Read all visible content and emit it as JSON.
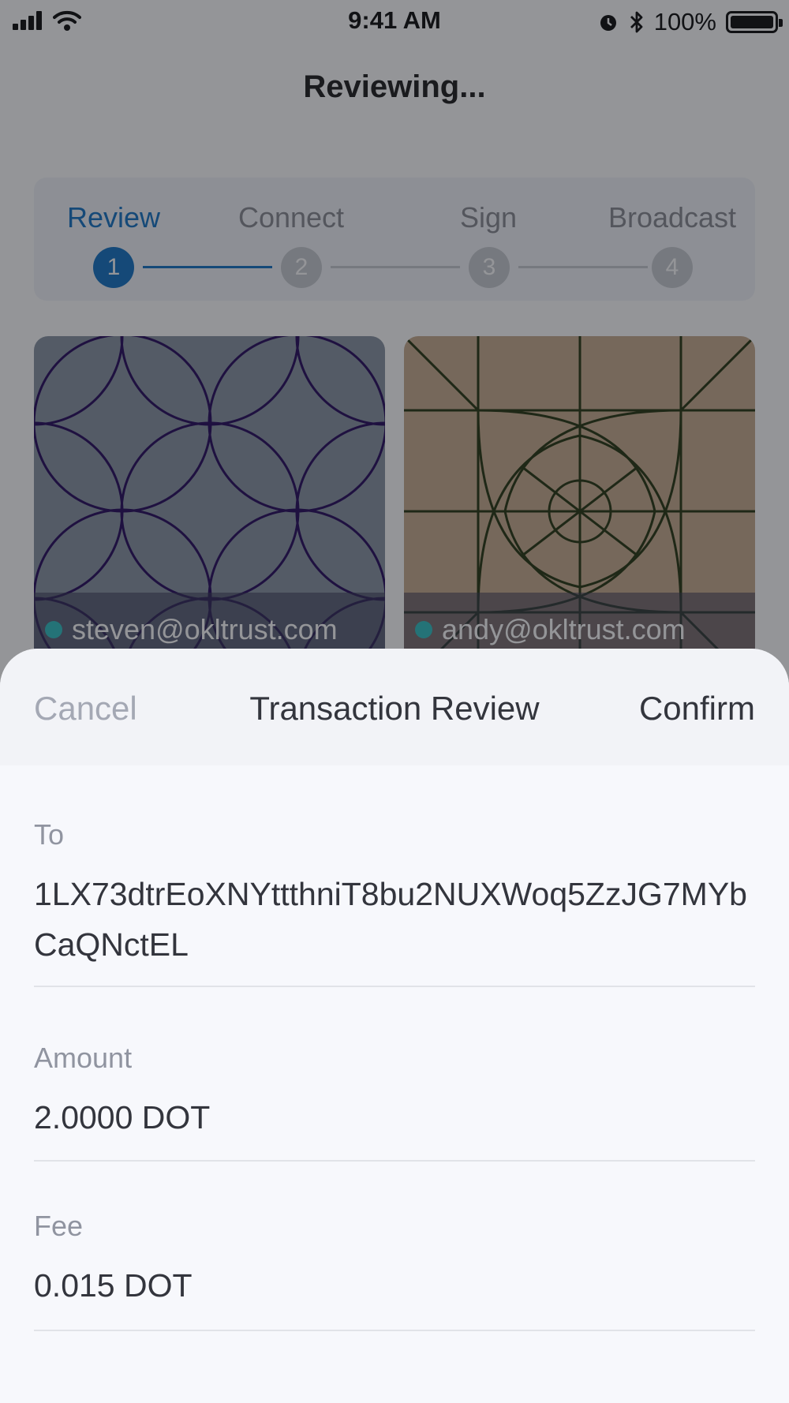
{
  "status_bar": {
    "time": "9:41 AM",
    "battery": "100%"
  },
  "nav": {
    "title": "Reviewing..."
  },
  "stepper": {
    "steps": [
      {
        "label": "Review",
        "number": "1",
        "active": true
      },
      {
        "label": "Connect",
        "number": "2",
        "active": false
      },
      {
        "label": "Sign",
        "number": "3",
        "active": false
      },
      {
        "label": "Broadcast",
        "number": "4",
        "active": false
      }
    ]
  },
  "cards": [
    {
      "email": "steven@okltrust.com",
      "color": "#8a96a5",
      "pattern_color": "#2a0f60"
    },
    {
      "email": "andy@okltrust.com",
      "color": "#c9ae90",
      "pattern_color": "#2a3a14"
    }
  ],
  "sheet": {
    "cancel_label": "Cancel",
    "title": "Transaction Review",
    "confirm_label": "Confirm",
    "fields": [
      {
        "label": "To",
        "value": "1LX73dtrEoXNYttthniT8bu2NUXWoq5ZzJG7MYbCaQNctEL"
      },
      {
        "label": "Amount",
        "value": "2.0000 DOT"
      },
      {
        "label": "Fee",
        "value": "0.015 DOT"
      }
    ]
  },
  "colors": {
    "accent": "#1976c5",
    "inactive": "#c9ccd1",
    "sheet_bg": "#f7f8fc"
  }
}
